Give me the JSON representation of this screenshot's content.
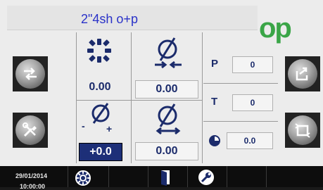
{
  "header": {
    "title": "2\"4sh o+p",
    "logo": "op",
    "logo_color": "#3aa547",
    "title_color": "#2a32c8"
  },
  "side_buttons": {
    "left_top": {
      "icon": "swap-arrows-icon"
    },
    "left_bottom": {
      "icon": "tools-icon"
    },
    "right_top": {
      "icon": "export-arrow-icon"
    },
    "right_bottom": {
      "icon": "refresh-frame-icon"
    }
  },
  "readouts": {
    "rotation_value": "0.00",
    "diameter_in_value": "0.00",
    "tolerance_value": "+0.0",
    "diameter_out_value": "0.00",
    "tolerance_minus": "-",
    "tolerance_plus": "+"
  },
  "params": {
    "p_label": "P",
    "p_value": "0",
    "t_label": "T",
    "t_value": "0",
    "timer_value": "0.0"
  },
  "taskbar": {
    "date": "29/01/2014",
    "time": "10:00:00"
  },
  "colors": {
    "value_text": "#1b2b6b",
    "selected_bg": "#1d2f78",
    "panel_bg": "#ececec"
  }
}
